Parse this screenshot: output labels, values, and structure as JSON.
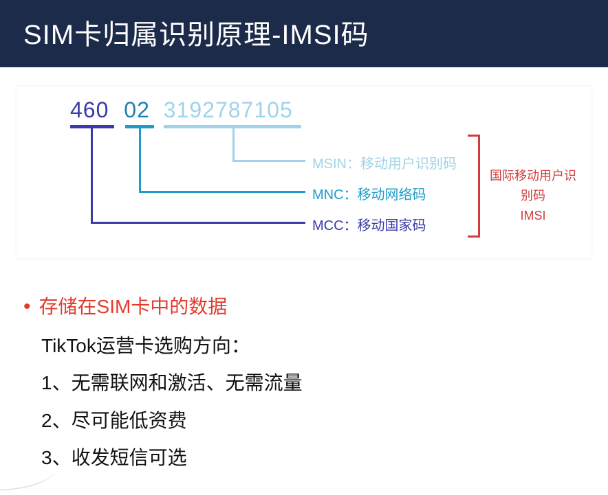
{
  "header": {
    "title": "SIM卡归属识别原理-IMSI码"
  },
  "imsi": {
    "mcc": "460",
    "mnc": "02",
    "msin": "3192787105",
    "labels": {
      "msin": "MSIN：移动用户识别码",
      "mnc": "MNC：移动网络码",
      "mcc": "MCC：移动国家码"
    },
    "side": {
      "line1": "国际移动用户识别码",
      "line2": "IMSI"
    }
  },
  "body": {
    "bullet": "存储在SIM卡中的数据",
    "subtitle": "TikTok运营卡选购方向：",
    "items": [
      "1、无需联网和激活、无需流量",
      "2、尽可能低资费",
      "3、收发短信可选"
    ]
  }
}
